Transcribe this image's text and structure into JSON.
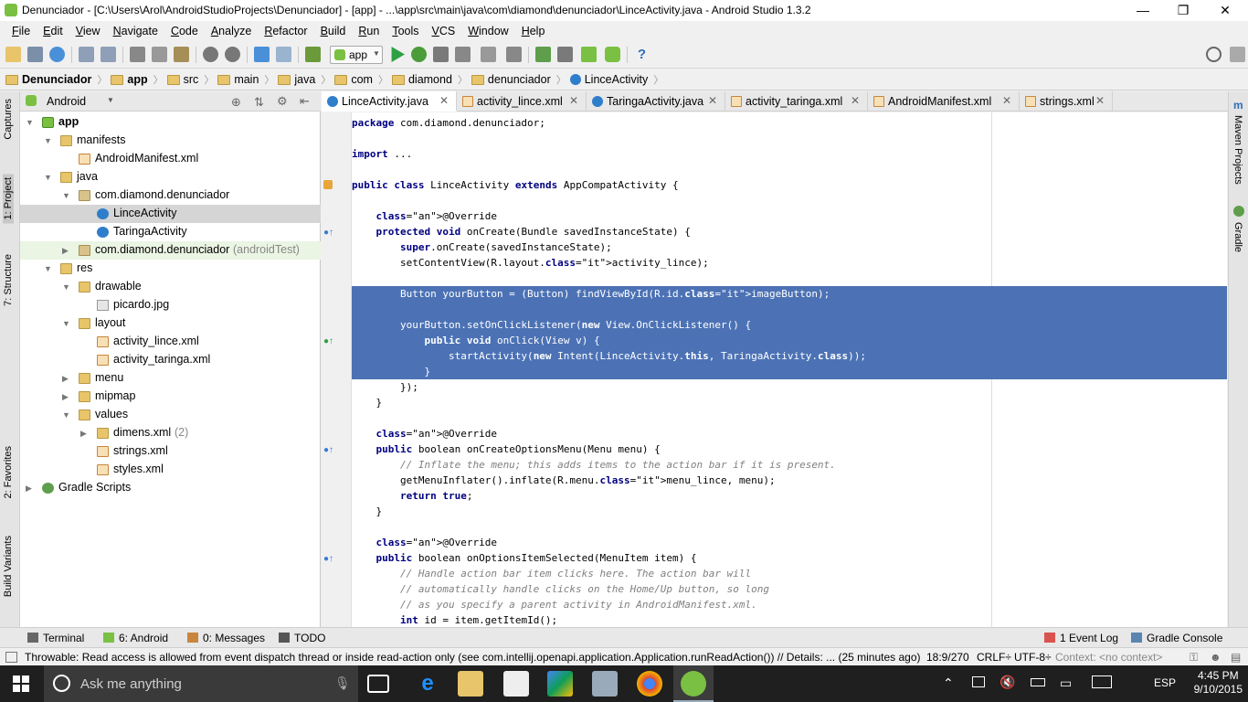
{
  "window": {
    "title": "Denunciador - [C:\\Users\\Arol\\AndroidStudioProjects\\Denunciador] - [app] - ...\\app\\src\\main\\java\\com\\diamond\\denunciador\\LinceActivity.java - Android Studio 1.3.2",
    "minimize": "—",
    "maximize": "❐",
    "close": "✕"
  },
  "menu": [
    "File",
    "Edit",
    "View",
    "Navigate",
    "Code",
    "Analyze",
    "Refactor",
    "Build",
    "Run",
    "Tools",
    "VCS",
    "Window",
    "Help"
  ],
  "toolbar": {
    "run_config": "app",
    "help": "?"
  },
  "breadcrumbs": [
    "Denunciador",
    "app",
    "src",
    "main",
    "java",
    "com",
    "diamond",
    "denunciador",
    "LinceActivity"
  ],
  "left_strip": {
    "captures": "Captures",
    "project": "1: Project",
    "structure": "7: Structure",
    "favorites": "2: Favorites",
    "build_variants": "Build Variants"
  },
  "right_strip": {
    "maven": "Maven Projects",
    "gradle": "Gradle"
  },
  "project_panel": {
    "view_selector": "Android",
    "tree": [
      {
        "label": "app",
        "indent": 0,
        "icon": "app",
        "open": true
      },
      {
        "label": "manifests",
        "indent": 1,
        "icon": "folder",
        "open": true
      },
      {
        "label": "AndroidManifest.xml",
        "indent": 2,
        "icon": "xml"
      },
      {
        "label": "java",
        "indent": 1,
        "icon": "folder",
        "open": true
      },
      {
        "label": "com.diamond.denunciador",
        "indent": 2,
        "icon": "pkg",
        "open": true
      },
      {
        "label": "LinceActivity",
        "indent": 3,
        "icon": "class",
        "selected": true
      },
      {
        "label": "TaringaActivity",
        "indent": 3,
        "icon": "class"
      },
      {
        "label": "com.diamond.denunciador",
        "suffix": "(androidTest)",
        "indent": 2,
        "icon": "pkg",
        "open": false,
        "tinted": true
      },
      {
        "label": "res",
        "indent": 1,
        "icon": "folder",
        "open": true
      },
      {
        "label": "drawable",
        "indent": 2,
        "icon": "folder",
        "open": true
      },
      {
        "label": "picardo.jpg",
        "indent": 3,
        "icon": "img"
      },
      {
        "label": "layout",
        "indent": 2,
        "icon": "folder",
        "open": true
      },
      {
        "label": "activity_lince.xml",
        "indent": 3,
        "icon": "xml"
      },
      {
        "label": "activity_taringa.xml",
        "indent": 3,
        "icon": "xml"
      },
      {
        "label": "menu",
        "indent": 2,
        "icon": "folder",
        "open": false
      },
      {
        "label": "mipmap",
        "indent": 2,
        "icon": "folder",
        "open": false
      },
      {
        "label": "values",
        "indent": 2,
        "icon": "folder",
        "open": true
      },
      {
        "label": "dimens.xml",
        "suffix": "(2)",
        "indent": 3,
        "icon": "folder",
        "open": false
      },
      {
        "label": "strings.xml",
        "indent": 3,
        "icon": "xml"
      },
      {
        "label": "styles.xml",
        "indent": 3,
        "icon": "xml"
      },
      {
        "label": "Gradle Scripts",
        "indent": 0,
        "icon": "gradle",
        "open": false
      }
    ]
  },
  "tabs": [
    {
      "label": "LinceActivity.java",
      "icon": "class",
      "active": true
    },
    {
      "label": "activity_lince.xml",
      "icon": "xml"
    },
    {
      "label": "TaringaActivity.java",
      "icon": "class"
    },
    {
      "label": "activity_taringa.xml",
      "icon": "xml"
    },
    {
      "label": "AndroidManifest.xml",
      "icon": "xml"
    },
    {
      "label": "strings.xml",
      "icon": "xml"
    }
  ],
  "code_lines": [
    "package com.diamond.denunciador;",
    "",
    "import ...",
    "",
    "public class LinceActivity extends AppCompatActivity {",
    "",
    "    @Override",
    "    protected void onCreate(Bundle savedInstanceState) {",
    "        super.onCreate(savedInstanceState);",
    "        setContentView(R.layout.activity_lince);",
    "",
    "        Button yourButton = (Button) findViewById(R.id.imageButton);",
    "",
    "        yourButton.setOnClickListener(new View.OnClickListener() {",
    "            public void onClick(View v) {",
    "                startActivity(new Intent(LinceActivity.this, TaringaActivity.class));",
    "            }",
    "        });",
    "    }",
    "",
    "    @Override",
    "    public boolean onCreateOptionsMenu(Menu menu) {",
    "        // Inflate the menu; this adds items to the action bar if it is present.",
    "        getMenuInflater().inflate(R.menu.menu_lince, menu);",
    "        return true;",
    "    }",
    "",
    "    @Override",
    "    public boolean onOptionsItemSelected(MenuItem item) {",
    "        // Handle action bar item clicks here. The action bar will",
    "        // automatically handle clicks on the Home/Up button, so long",
    "        // as you specify a parent activity in AndroidManifest.xml.",
    "        int id = item.getItemId();"
  ],
  "bottom_tools": {
    "terminal": "Terminal",
    "android": "6: Android",
    "messages": "0: Messages",
    "todo": "TODO",
    "event_log": "1 Event Log",
    "gradle_console": "Gradle Console"
  },
  "status": {
    "message": "Throwable: Read access is allowed from event dispatch thread or inside read-action only (see com.intellij.openapi.application.Application.runReadAction()) // Details: ... (25 minutes ago)",
    "position": "18:9/270",
    "line_sep": "CRLF÷",
    "encoding": "UTF-8÷",
    "context": "Context: <no context>"
  },
  "taskbar": {
    "search": "Ask me anything",
    "lang": "ESP",
    "time": "4:45 PM",
    "date": "9/10/2015"
  },
  "colors": {
    "selection": "#4c72b5",
    "keyword": "#000080",
    "annotation": "#808000",
    "comment": "#808080"
  }
}
